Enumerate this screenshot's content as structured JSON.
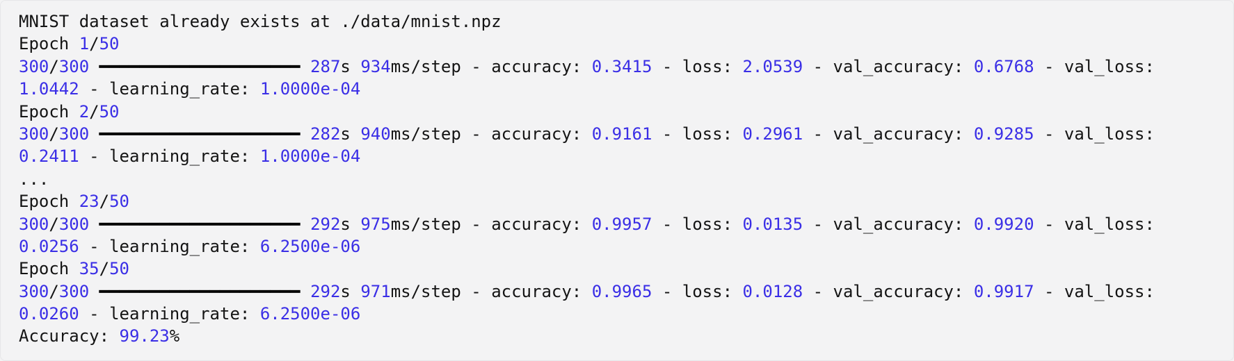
{
  "initial_message": "MNIST dataset already exists at ./data/mnist.npz",
  "total_epochs": 50,
  "steps_done": 300,
  "steps_total": 300,
  "progress_bar": "━━━━━━━━━━━━━━━━━━━━",
  "ellipsis": "...",
  "epochs": [
    {
      "n": 1,
      "time_s": 287,
      "ms_step": 934,
      "accuracy": 0.3415,
      "loss": 2.0539,
      "val_accuracy": 0.6768,
      "val_loss": 1.0442,
      "learning_rate": "1.0000e-04"
    },
    {
      "n": 2,
      "time_s": 282,
      "ms_step": 940,
      "accuracy": 0.9161,
      "loss": 0.2961,
      "val_accuracy": 0.9285,
      "val_loss": 0.2411,
      "learning_rate": "1.0000e-04"
    },
    {
      "n": 23,
      "time_s": 292,
      "ms_step": 975,
      "accuracy": 0.9957,
      "loss": 0.0135,
      "val_accuracy": 0.992,
      "val_loss": 0.0256,
      "learning_rate": "6.2500e-06"
    },
    {
      "n": 35,
      "time_s": 292,
      "ms_step": 971,
      "accuracy": 0.9965,
      "loss": 0.0128,
      "val_accuracy": 0.9917,
      "val_loss": 0.026,
      "learning_rate": "6.2500e-06"
    }
  ],
  "final": {
    "label": "Accuracy: ",
    "value": 99.23,
    "suffix": "%"
  },
  "labels": {
    "epoch": "Epoch ",
    "msstep": "ms/step",
    "acc": "accuracy: ",
    "loss": "loss: ",
    "vacc": "val_accuracy: ",
    "vloss": "val_loss: ",
    "lr": "learning_rate: "
  }
}
